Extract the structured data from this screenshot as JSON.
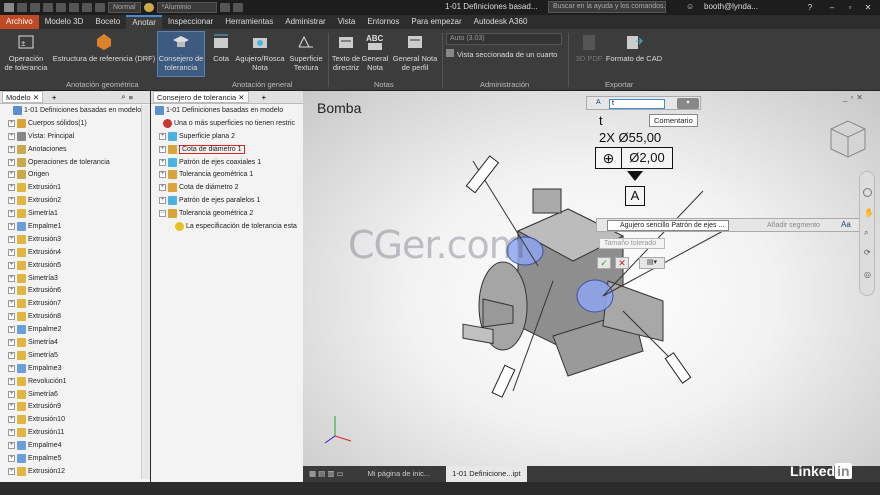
{
  "titlebar": {
    "style_box": "Normal",
    "material": "*Aluminio",
    "doc_title": "1-01 Definiciones basad...",
    "help_search": "Buscar en la ayuda y los comandos...",
    "user": "booth@lynda..."
  },
  "tabs": [
    "Archivo",
    "Modelo 3D",
    "Boceto",
    "Anotar",
    "Inspeccionar",
    "Herramientas",
    "Administrar",
    "Vista",
    "Entornos",
    "Para empezar",
    "Autodesk A360"
  ],
  "ribbon": {
    "operacion": "Operación de tolerancia",
    "estructura": "Estructura de referencia (DRF)",
    "consejero": "Consejero de tolerancia",
    "cota": "Cota",
    "agujero": "Agujero/Rosca Nota",
    "superficie": "Superficie Textura",
    "texto": "Texto de directriz",
    "general_nota": "General Nota",
    "general_perfil": "General Nota de perfil",
    "auto": "Auto (3.03)",
    "vista_sec": "Vista seccionada de un cuarto",
    "pdf": "3D PDF",
    "cad": "Formato de CAD",
    "g_anot_geo": "Anotación geométrica",
    "g_anot_gen": "Anotación general",
    "g_notas": "Notas",
    "g_admin": "Administración",
    "g_exportar": "Exportar"
  },
  "model_panel": {
    "title": "Modelo",
    "items": [
      "1-01 Definiciones basadas en modelo",
      "Cuerpos sólidos(1)",
      "Vista: Principal",
      "Anotaciones",
      "Operaciones de tolerancia",
      "Origen",
      "Extrusión1",
      "Extrusión2",
      "Simetría1",
      "Empalme1",
      "Extrusión3",
      "Extrusión4",
      "Extrusión5",
      "Simetría3",
      "Extrusión6",
      "Extrusión7",
      "Extrusión8",
      "Empalme2",
      "Simetría4",
      "Simetría5",
      "Empalme3",
      "Revolución1",
      "Simetría6",
      "Extrusión9",
      "Extrusión10",
      "Extrusión11",
      "Empalme4",
      "Empalme5",
      "Extrusión12"
    ]
  },
  "advisor_panel": {
    "title": "Consejero de tolerancia",
    "items": [
      "1-01 Definiciones basadas en modelo",
      "Una o más superficies no tienen restric",
      "Superficie plana 2",
      "Cota de diámetro 1",
      "Patrón de ejes coaxiales 1",
      "Tolerancia geométrica 1",
      "Cota de diámetro 2",
      "Patrón de ejes paralelos 1",
      "Tolerancia geométrica 2",
      "La especificación de tolerancia esta"
    ]
  },
  "viewport": {
    "title": "Bomba",
    "note_input": "t",
    "tooltip": "Comentario",
    "annot_t": "t",
    "annot_2x": "2X Ø55,00",
    "fcf_tol": "Ø2,00",
    "datum": "A",
    "hole_dd": "Agujero sencillo Patrón de ejes ...",
    "add_seg": "Añadir segmento",
    "size_tol": "Tamaño tolerado",
    "watermark": "CGer.com"
  },
  "bottom_tabs": [
    "Mi página de inic...",
    "1-01 Definicione...ipt"
  ],
  "brand": "Linked"
}
